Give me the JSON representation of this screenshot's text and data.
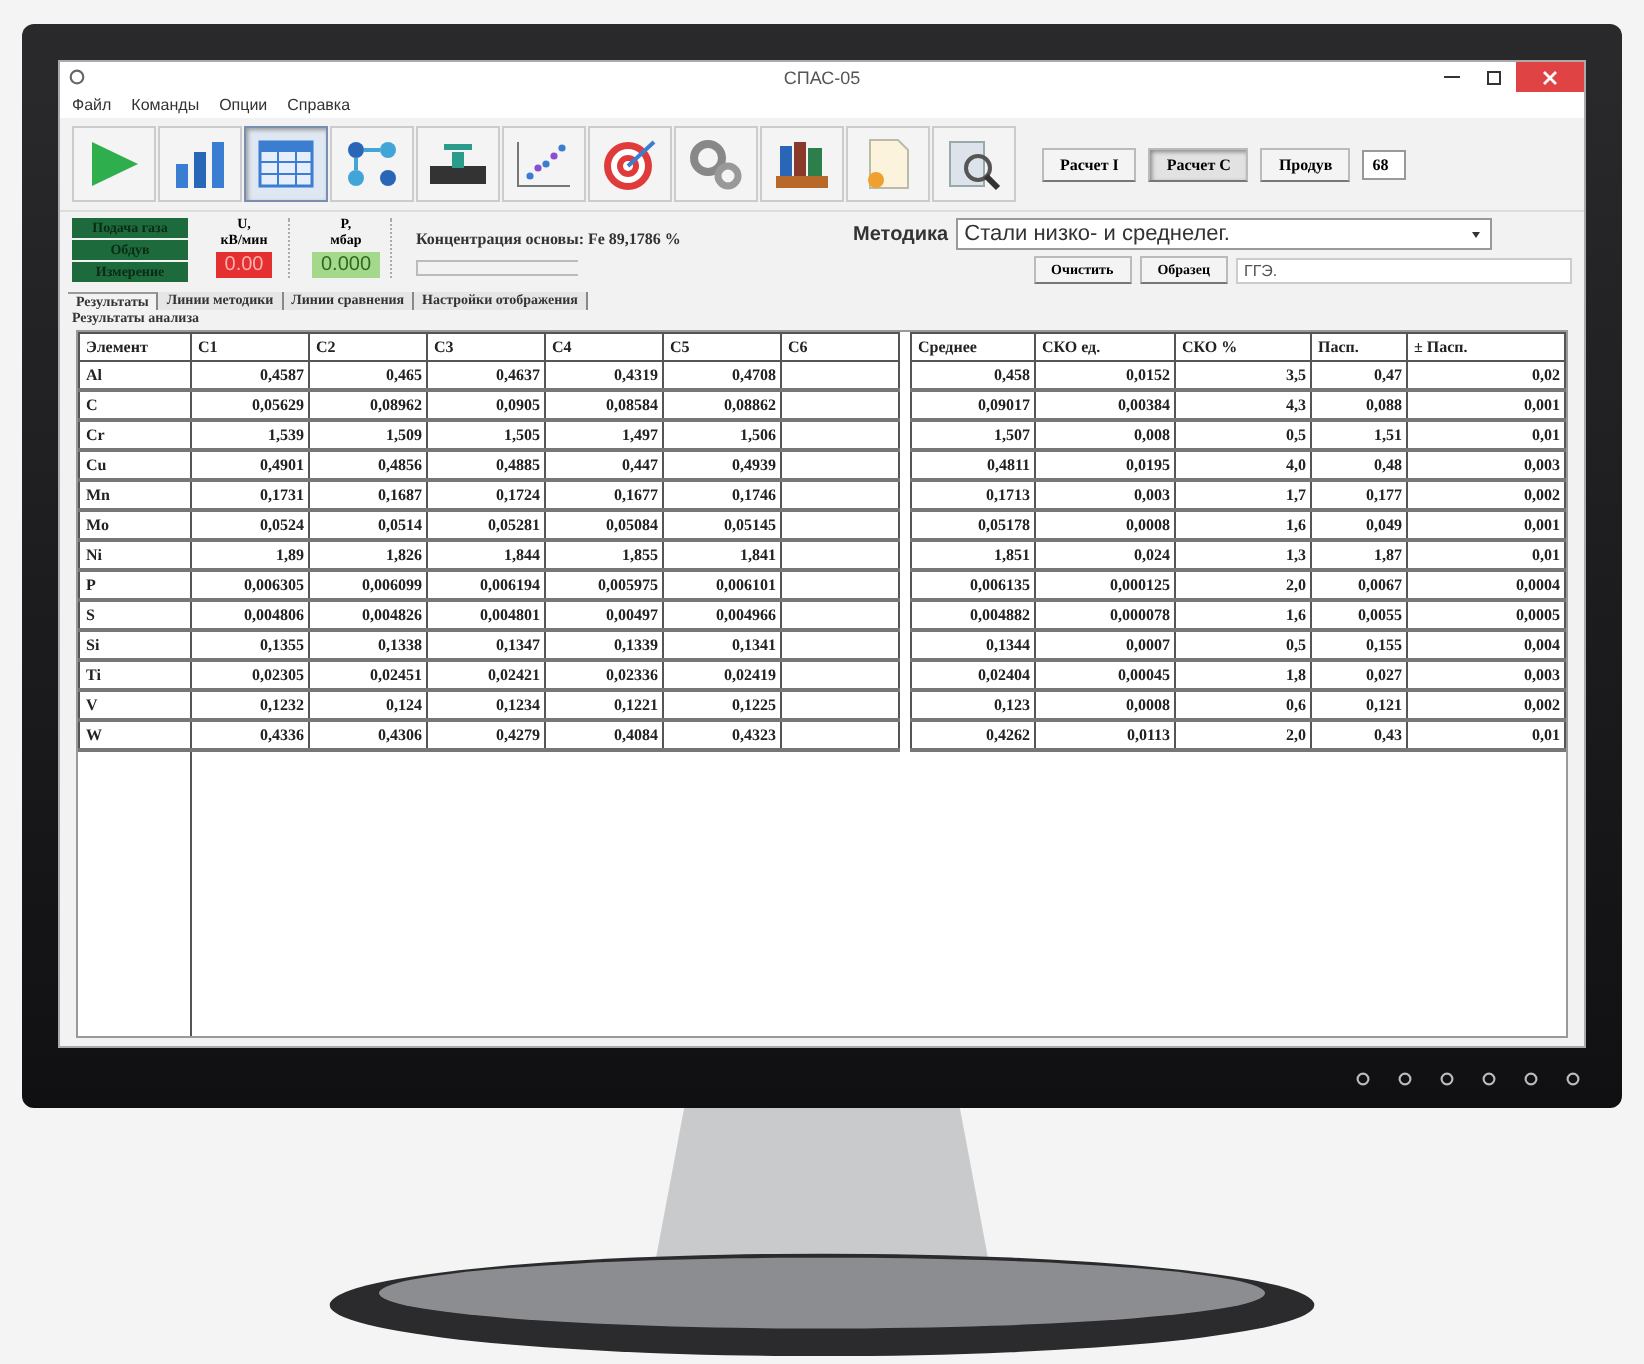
{
  "window": {
    "title": "СПАС-05"
  },
  "menu": [
    "Файл",
    "Команды",
    "Опции",
    "Справка"
  ],
  "toolbar": [
    {
      "kind": "play",
      "selected": false
    },
    {
      "kind": "bars",
      "selected": false
    },
    {
      "kind": "table",
      "selected": true
    },
    {
      "kind": "nodes",
      "selected": false
    },
    {
      "kind": "valve",
      "selected": false
    },
    {
      "kind": "scatter",
      "selected": false
    },
    {
      "kind": "target",
      "selected": false
    },
    {
      "kind": "gears",
      "selected": false
    },
    {
      "kind": "books",
      "selected": false
    },
    {
      "kind": "document",
      "selected": false
    },
    {
      "kind": "magnifier",
      "selected": false
    }
  ],
  "calc_buttons": [
    {
      "label": "Расчет I",
      "pressed": false
    },
    {
      "label": "Расчет C",
      "pressed": true
    },
    {
      "label": "Продув",
      "pressed": false
    }
  ],
  "counter": "68",
  "indicators": [
    "Подача газа",
    "Обдув",
    "Измерение"
  ],
  "gauges": [
    {
      "label": "U,",
      "unit": "кВ/мин",
      "value": "0.00",
      "kind": "alarm"
    },
    {
      "label": "P,",
      "unit": "мбар",
      "value": "0.000",
      "kind": "ok"
    }
  ],
  "concentration": {
    "text": "Концентрация основы: Fe  89,1786 %",
    "level": 0
  },
  "method": {
    "label": "Методика",
    "value": "Стали низко- и среднелег."
  },
  "sample_buttons": [
    "Очистить",
    "Образец"
  ],
  "sample_field": "ГГЭ.",
  "tabs": [
    {
      "label": "Результаты",
      "selected": true
    },
    {
      "label": "Линии методики",
      "selected": false
    },
    {
      "label": "Линии сравнения",
      "selected": false
    },
    {
      "label": "Настройки отображения",
      "selected": false
    }
  ],
  "section_title": "Результаты анализа",
  "table": {
    "columns": [
      "Элемент",
      "C1",
      "C2",
      "C3",
      "C4",
      "C5",
      "C6"
    ],
    "stat_columns": [
      "Среднее",
      "СКО ед.",
      "СКО %",
      "Пасп.",
      "± Пасп."
    ],
    "rows": [
      {
        "element": "Al",
        "values": [
          "0,4587",
          "0,465",
          "0,4637",
          "0,4319",
          "0,4708"
        ],
        "stats": [
          "0,458",
          "0,0152",
          "3,5",
          "0,47",
          "0,02"
        ]
      },
      {
        "element": "C",
        "values": [
          "0,05629",
          "0,08962",
          "0,0905",
          "0,08584",
          "0,08862"
        ],
        "stats": [
          "0,09017",
          "0,00384",
          "4,3",
          "0,088",
          "0,001"
        ]
      },
      {
        "element": "Cr",
        "values": [
          "1,539",
          "1,509",
          "1,505",
          "1,497",
          "1,506"
        ],
        "stats": [
          "1,507",
          "0,008",
          "0,5",
          "1,51",
          "0,01"
        ]
      },
      {
        "element": "Cu",
        "values": [
          "0,4901",
          "0,4856",
          "0,4885",
          "0,447",
          "0,4939"
        ],
        "stats": [
          "0,4811",
          "0,0195",
          "4,0",
          "0,48",
          "0,003"
        ]
      },
      {
        "element": "Mn",
        "values": [
          "0,1731",
          "0,1687",
          "0,1724",
          "0,1677",
          "0,1746"
        ],
        "stats": [
          "0,1713",
          "0,003",
          "1,7",
          "0,177",
          "0,002"
        ]
      },
      {
        "element": "Mo",
        "values": [
          "0,0524",
          "0,0514",
          "0,05281",
          "0,05084",
          "0,05145"
        ],
        "stats": [
          "0,05178",
          "0,0008",
          "1,6",
          "0,049",
          "0,001"
        ]
      },
      {
        "element": "Ni",
        "values": [
          "1,89",
          "1,826",
          "1,844",
          "1,855",
          "1,841"
        ],
        "stats": [
          "1,851",
          "0,024",
          "1,3",
          "1,87",
          "0,01"
        ]
      },
      {
        "element": "P",
        "values": [
          "0,006305",
          "0,006099",
          "0,006194",
          "0,005975",
          "0,006101"
        ],
        "stats": [
          "0,006135",
          "0,000125",
          "2,0",
          "0,0067",
          "0,0004"
        ]
      },
      {
        "element": "S",
        "values": [
          "0,004806",
          "0,004826",
          "0,004801",
          "0,00497",
          "0,004966"
        ],
        "stats": [
          "0,004882",
          "0,000078",
          "1,6",
          "0,0055",
          "0,0005"
        ]
      },
      {
        "element": "Si",
        "values": [
          "0,1355",
          "0,1338",
          "0,1347",
          "0,1339",
          "0,1341"
        ],
        "stats": [
          "0,1344",
          "0,0007",
          "0,5",
          "0,155",
          "0,004"
        ]
      },
      {
        "element": "Ti",
        "values": [
          "0,02305",
          "0,02451",
          "0,02421",
          "0,02336",
          "0,02419"
        ],
        "stats": [
          "0,02404",
          "0,00045",
          "1,8",
          "0,027",
          "0,003"
        ]
      },
      {
        "element": "V",
        "values": [
          "0,1232",
          "0,124",
          "0,1234",
          "0,1221",
          "0,1225"
        ],
        "stats": [
          "0,123",
          "0,0008",
          "0,6",
          "0,121",
          "0,002"
        ]
      },
      {
        "element": "W",
        "values": [
          "0,4336",
          "0,4306",
          "0,4279",
          "0,4084",
          "0,4323"
        ],
        "stats": [
          "0,4262",
          "0,0113",
          "2,0",
          "0,43",
          "0,01"
        ]
      }
    ]
  }
}
